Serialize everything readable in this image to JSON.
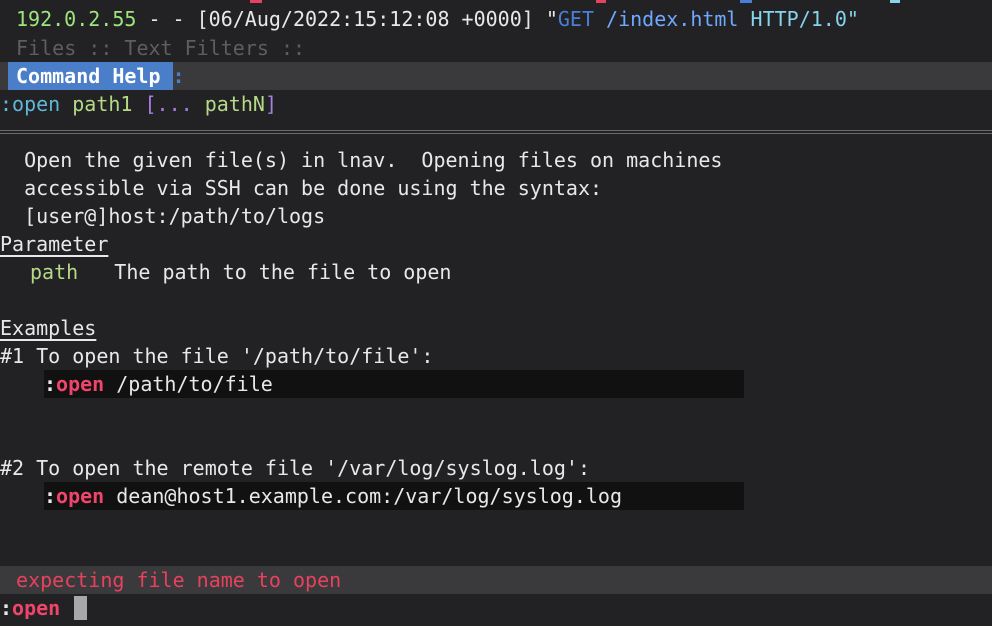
{
  "log_line": {
    "ip": "192.0.2.55",
    "middle": " - - [06/Aug/2022:15:12:08 +0000] \"",
    "method": "GET",
    "url": " /index.html",
    "protocol": " HTTP/1.0\""
  },
  "tabs": {
    "text": " Files :: Text Filters ::"
  },
  "help_bar": {
    "title": "Command Help ",
    "separator": ":"
  },
  "synopsis": {
    "colon": ":",
    "command": "open",
    "param": " path1",
    "optional": " [... ",
    "param_n": "pathN",
    "close": "]"
  },
  "description": {
    "line1": "  Open the given file(s) in lnav.  Opening files on machines",
    "line2": "  accessible via SSH can be done using the syntax:",
    "line3": "  [user@]host:/path/to/logs"
  },
  "parameter": {
    "heading": "Parameter",
    "name": "path",
    "desc": "   The path to the file to open"
  },
  "examples": {
    "heading": "Examples",
    "items": [
      {
        "title": "#1 To open the file '/path/to/file':",
        "colon": ":",
        "command": "open",
        "arg": " /path/to/file"
      },
      {
        "title": "#2 To open the remote file '/var/log/syslog.log':",
        "colon": ":",
        "command": "open",
        "arg": " dean@host1.example.com:/var/log/syslog.log"
      }
    ]
  },
  "status": {
    "error": " expecting file name to open"
  },
  "prompt": {
    "colon": ":",
    "command": "open"
  }
}
